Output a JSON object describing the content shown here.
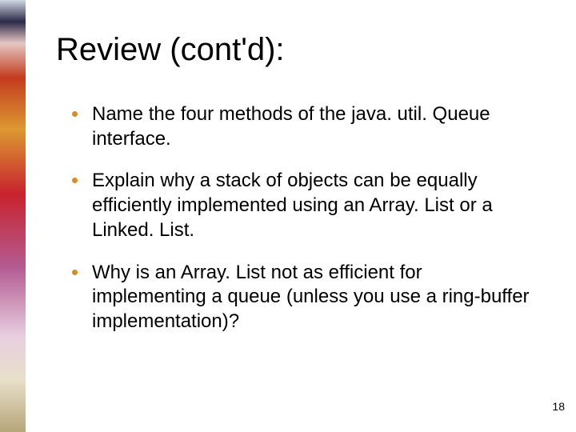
{
  "slide": {
    "title": "Review (cont'd):",
    "bullets": [
      "Name the four methods of the java. util. Queue interface.",
      "Explain why a stack of objects can be equally efficiently implemented using an Array. List or a Linked. List.",
      "Why is an Array. List not as efficient for implementing a queue (unless you use a ring-buffer implementation)?"
    ],
    "page_number": "18"
  }
}
